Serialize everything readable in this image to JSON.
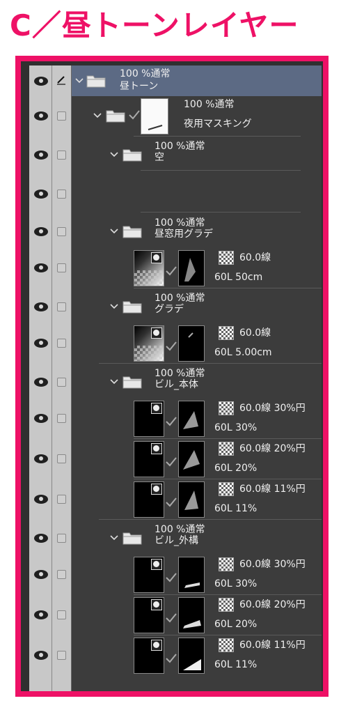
{
  "header": {
    "title": "C／昼トーンレイヤー"
  },
  "colors": {
    "accent": "#ee1166",
    "selected_row": "#5c6a84",
    "panel_bg": "#3c3c3c"
  },
  "layers": {
    "root": {
      "opacity_blend": "100 %通常",
      "name": "昼トーン"
    },
    "night_mask": {
      "opacity_blend": "100 %通常",
      "name": "夜用マスキング"
    },
    "sky": {
      "opacity_blend": "100 %通常",
      "name": "空"
    },
    "window": {
      "opacity_blend": "100 %通常",
      "name": "昼窓用グラデ",
      "tone": {
        "screen": "60.0線",
        "detail": "60L 50cm"
      }
    },
    "grad": {
      "opacity_blend": "100 %通常",
      "name": "グラデ",
      "tone": {
        "screen": "60.0線",
        "detail": "60L 5.00cm"
      }
    },
    "building_body": {
      "opacity_blend": "100 %通常",
      "name": "ビル_本体",
      "tones": [
        {
          "screen": "60.0線 30%円",
          "detail": "60L 30%"
        },
        {
          "screen": "60.0線 20%円",
          "detail": "60L 20%"
        },
        {
          "screen": "60.0線 11%円",
          "detail": "60L 11%"
        }
      ]
    },
    "building_exterior": {
      "opacity_blend": "100 %通常",
      "name": "ビル_外構",
      "tones": [
        {
          "screen": "60.0線 30%円",
          "detail": "60L 30%"
        },
        {
          "screen": "60.0線 20%円",
          "detail": "60L 20%"
        },
        {
          "screen": "60.0線 11%円",
          "detail": "60L 11%"
        }
      ]
    }
  },
  "icons": {
    "visibility": "eye-icon",
    "lock": "checkbox",
    "edit": "pencil-icon",
    "folder": "folder-icon",
    "expand": "chevron-down-icon",
    "clip": "check-icon",
    "tone": "screentone-icon"
  }
}
